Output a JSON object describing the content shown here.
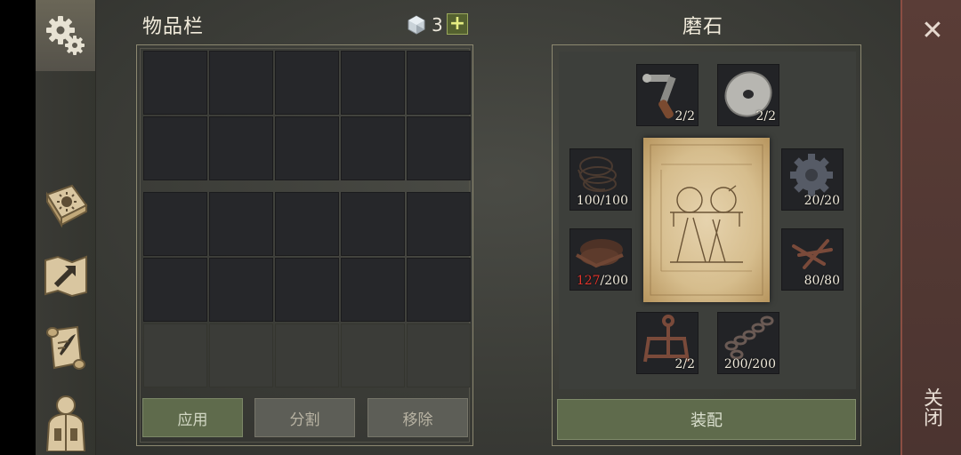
{
  "inventory": {
    "title": "物品栏",
    "currency_count": "3",
    "add_symbol": "+"
  },
  "buttons": {
    "apply": "应用",
    "split": "分割",
    "remove": "移除",
    "equip": "装配"
  },
  "crafting": {
    "title": "磨石",
    "slots": [
      {
        "name": "crank-handle",
        "have": "2",
        "need": "2"
      },
      {
        "name": "grindstone-wheel",
        "have": "2",
        "need": "2"
      },
      {
        "name": "rope",
        "have": "100",
        "need": "100"
      },
      {
        "name": "gear",
        "have": "20",
        "need": "20"
      },
      {
        "name": "leather",
        "have": "127",
        "need": "200"
      },
      {
        "name": "nails",
        "have": "80",
        "need": "80"
      },
      {
        "name": "metal-bracket",
        "have": "2",
        "need": "2"
      },
      {
        "name": "chain",
        "have": "200",
        "need": "200"
      }
    ]
  },
  "close": {
    "symbol": "✕",
    "label": "关闭"
  },
  "colors": {
    "green_button": "#5f6b4c",
    "shortage_red": "#e0342c",
    "close_panel": "#5a3d37"
  },
  "icons": [
    "settings-gears-icon",
    "survival-guide-icon",
    "map-icon",
    "quest-scroll-icon",
    "character-icon"
  ]
}
